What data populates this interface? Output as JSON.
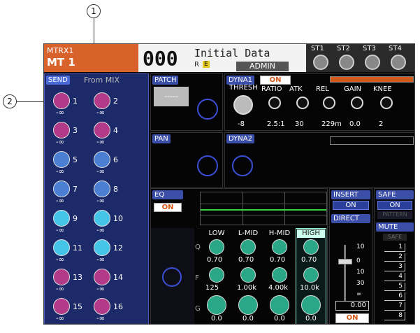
{
  "callouts": [
    "1",
    "2"
  ],
  "header": {
    "channel_type": "MTRX1",
    "channel_id": "MT 1",
    "scene_number": "000",
    "scene_title": "Initial Data",
    "scene_flags": "R",
    "scene_e": "E",
    "user": "ADMIN",
    "st_labels": [
      "ST1",
      "ST2",
      "ST3",
      "ST4"
    ]
  },
  "send": {
    "tag": "SEND",
    "title": "From MIX",
    "knobs": [
      {
        "n": "1",
        "v": "-∞",
        "color": "#b23a88"
      },
      {
        "n": "2",
        "v": "-∞",
        "color": "#b23a88"
      },
      {
        "n": "3",
        "v": "-∞",
        "color": "#b23a88"
      },
      {
        "n": "4",
        "v": "-∞",
        "color": "#b23a88"
      },
      {
        "n": "5",
        "v": "-∞",
        "color": "#4a7fd4"
      },
      {
        "n": "6",
        "v": "-∞",
        "color": "#4a7fd4"
      },
      {
        "n": "7",
        "v": "-∞",
        "color": "#4a7fd4"
      },
      {
        "n": "8",
        "v": "-∞",
        "color": "#4a7fd4"
      },
      {
        "n": "9",
        "v": "-∞",
        "color": "#45c5e8"
      },
      {
        "n": "10",
        "v": "-∞",
        "color": "#45c5e8"
      },
      {
        "n": "11",
        "v": "-∞",
        "color": "#45c5e8"
      },
      {
        "n": "12",
        "v": "-∞",
        "color": "#45c5e8"
      },
      {
        "n": "13",
        "v": "-∞",
        "color": "#b23a88"
      },
      {
        "n": "14",
        "v": "-∞",
        "color": "#b23a88"
      },
      {
        "n": "15",
        "v": "-∞",
        "color": "#b23a88"
      },
      {
        "n": "16",
        "v": "-∞",
        "color": "#b23a88"
      }
    ]
  },
  "patch": {
    "tag": "PATCH",
    "input": "-----"
  },
  "pan": {
    "tag": "PAN"
  },
  "dyna1": {
    "tag": "DYNA1",
    "on": "ON",
    "params": [
      {
        "label": "THRESH",
        "value": "-8"
      },
      {
        "label": "RATIO",
        "value": "2.5:1"
      },
      {
        "label": "ATK",
        "value": "30"
      },
      {
        "label": "REL",
        "value": "229m"
      },
      {
        "label": "GAIN",
        "value": "0.0"
      },
      {
        "label": "KNEE",
        "value": "2"
      }
    ]
  },
  "dyna2": {
    "tag": "DYNA2"
  },
  "eq": {
    "tag": "EQ",
    "on": "ON",
    "bands": [
      "LOW",
      "L-MID",
      "H-MID",
      "HIGH"
    ],
    "row_labels": [
      "Q",
      "F",
      "G"
    ],
    "q": [
      "0.70",
      "0.70",
      "0.70",
      "0.70"
    ],
    "f": [
      "125",
      "1.00k",
      "4.00k",
      "10.0k"
    ],
    "g": [
      "0.0",
      "0.0",
      "0.0",
      "0.0"
    ]
  },
  "insert": {
    "tag": "INSERT",
    "on": "ON"
  },
  "direct": {
    "tag": "DIRECT"
  },
  "safe": {
    "tag": "SAFE",
    "on": "ON",
    "sub": "PATTERN"
  },
  "mute": {
    "tag": "MUTE",
    "safe": "SAFE",
    "groups": [
      "1",
      "2",
      "3",
      "4",
      "5",
      "6",
      "7",
      "8"
    ]
  },
  "fader": {
    "scale": [
      "10",
      "0",
      "10",
      "30",
      "∞"
    ],
    "value": "0.00",
    "on": "ON"
  },
  "colors": {
    "accent": "#d45a1c",
    "blue": "#3b4fa8",
    "teal": "#2aa787"
  }
}
